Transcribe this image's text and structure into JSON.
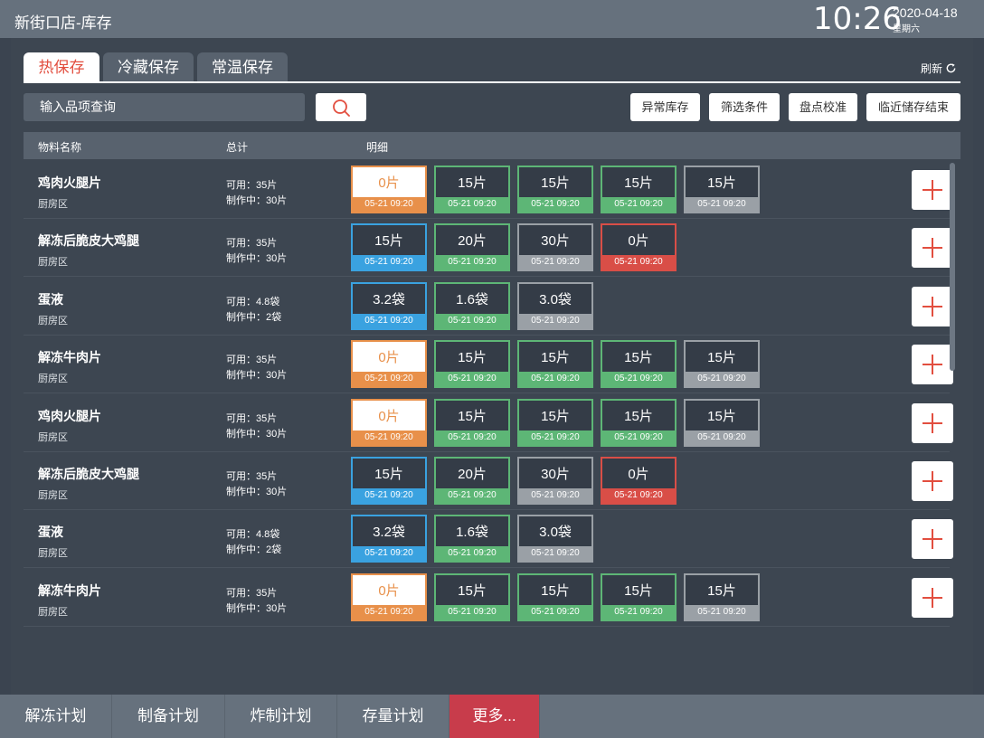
{
  "header": {
    "title": "新街口店-库存",
    "time": "10:26",
    "date": "2020-04-18",
    "weekday": "星期六"
  },
  "tabs": [
    {
      "label": "热保存",
      "active": true
    },
    {
      "label": "冷藏保存",
      "active": false
    },
    {
      "label": "常温保存",
      "active": false
    }
  ],
  "refresh_label": "刷新",
  "search": {
    "placeholder": "输入品项查询",
    "icon": "search-icon"
  },
  "actions": [
    "异常库存",
    "筛选条件",
    "盘点校准",
    "临近储存结束"
  ],
  "columns": [
    "物料名称",
    "总计",
    "明细"
  ],
  "colors": {
    "accent": "#e24e3f",
    "orange": "#e8904a",
    "green": "#5db676",
    "gray": "#9aa0a6",
    "blue": "#3aa2e0",
    "red": "#d94e47",
    "more": "#c83c4b"
  },
  "rows": [
    {
      "name": "鸡肉火腿片",
      "area": "厨房区",
      "available": "可用：35片",
      "making": "制作中：30片",
      "cells": [
        {
          "qty": "0片",
          "time": "05-21 09:20",
          "status": "orange"
        },
        {
          "qty": "15片",
          "time": "05-21 09:20",
          "status": "green"
        },
        {
          "qty": "15片",
          "time": "05-21 09:20",
          "status": "green"
        },
        {
          "qty": "15片",
          "time": "05-21 09:20",
          "status": "green"
        },
        {
          "qty": "15片",
          "time": "05-21 09:20",
          "status": "gray"
        }
      ]
    },
    {
      "name": "解冻后脆皮大鸡腿",
      "area": "厨房区",
      "available": "可用：35片",
      "making": "制作中：30片",
      "cells": [
        {
          "qty": "15片",
          "time": "05-21 09:20",
          "status": "blue"
        },
        {
          "qty": "20片",
          "time": "05-21 09:20",
          "status": "green"
        },
        {
          "qty": "30片",
          "time": "05-21 09:20",
          "status": "gray"
        },
        {
          "qty": "0片",
          "time": "05-21 09:20",
          "status": "red"
        }
      ]
    },
    {
      "name": "蛋液",
      "area": "厨房区",
      "available": "可用：4.8袋",
      "making": "制作中：2袋",
      "cells": [
        {
          "qty": "3.2袋",
          "time": "05-21 09:20",
          "status": "blue"
        },
        {
          "qty": "1.6袋",
          "time": "05-21 09:20",
          "status": "green"
        },
        {
          "qty": "3.0袋",
          "time": "05-21 09:20",
          "status": "gray"
        }
      ]
    },
    {
      "name": "解冻牛肉片",
      "area": "厨房区",
      "available": "可用：35片",
      "making": "制作中：30片",
      "cells": [
        {
          "qty": "0片",
          "time": "05-21 09:20",
          "status": "orange"
        },
        {
          "qty": "15片",
          "time": "05-21 09:20",
          "status": "green"
        },
        {
          "qty": "15片",
          "time": "05-21 09:20",
          "status": "green"
        },
        {
          "qty": "15片",
          "time": "05-21 09:20",
          "status": "green"
        },
        {
          "qty": "15片",
          "time": "05-21 09:20",
          "status": "gray"
        }
      ]
    },
    {
      "name": "鸡肉火腿片",
      "area": "厨房区",
      "available": "可用：35片",
      "making": "制作中：30片",
      "cells": [
        {
          "qty": "0片",
          "time": "05-21 09:20",
          "status": "orange"
        },
        {
          "qty": "15片",
          "time": "05-21 09:20",
          "status": "green"
        },
        {
          "qty": "15片",
          "time": "05-21 09:20",
          "status": "green"
        },
        {
          "qty": "15片",
          "time": "05-21 09:20",
          "status": "green"
        },
        {
          "qty": "15片",
          "time": "05-21 09:20",
          "status": "gray"
        }
      ]
    },
    {
      "name": "解冻后脆皮大鸡腿",
      "area": "厨房区",
      "available": "可用：35片",
      "making": "制作中：30片",
      "cells": [
        {
          "qty": "15片",
          "time": "05-21 09:20",
          "status": "blue"
        },
        {
          "qty": "20片",
          "time": "05-21 09:20",
          "status": "green"
        },
        {
          "qty": "30片",
          "time": "05-21 09:20",
          "status": "gray"
        },
        {
          "qty": "0片",
          "time": "05-21 09:20",
          "status": "red"
        }
      ]
    },
    {
      "name": "蛋液",
      "area": "厨房区",
      "available": "可用：4.8袋",
      "making": "制作中：2袋",
      "cells": [
        {
          "qty": "3.2袋",
          "time": "05-21 09:20",
          "status": "blue"
        },
        {
          "qty": "1.6袋",
          "time": "05-21 09:20",
          "status": "green"
        },
        {
          "qty": "3.0袋",
          "time": "05-21 09:20",
          "status": "gray"
        }
      ]
    },
    {
      "name": "解冻牛肉片",
      "area": "厨房区",
      "available": "可用：35片",
      "making": "制作中：30片",
      "cells": [
        {
          "qty": "0片",
          "time": "05-21 09:20",
          "status": "orange"
        },
        {
          "qty": "15片",
          "time": "05-21 09:20",
          "status": "green"
        },
        {
          "qty": "15片",
          "time": "05-21 09:20",
          "status": "green"
        },
        {
          "qty": "15片",
          "time": "05-21 09:20",
          "status": "green"
        },
        {
          "qty": "15片",
          "time": "05-21 09:20",
          "status": "gray"
        }
      ]
    }
  ],
  "bottom_nav": [
    "解冻计划",
    "制备计划",
    "炸制计划",
    "存量计划",
    "更多..."
  ]
}
